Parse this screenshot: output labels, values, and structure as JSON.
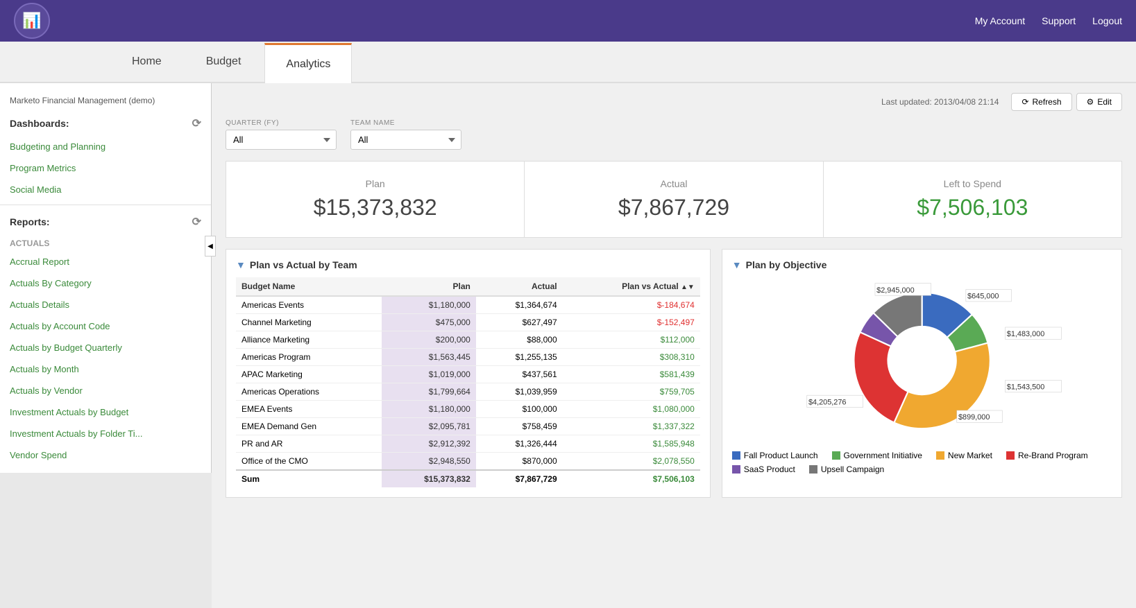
{
  "topbar": {
    "nav_links": [
      "My Account",
      "Support",
      "Logout"
    ]
  },
  "nav_tabs": [
    {
      "label": "Home",
      "active": false
    },
    {
      "label": "Budget",
      "active": false
    },
    {
      "label": "Analytics",
      "active": true
    }
  ],
  "sidebar": {
    "company": "Marketo Financial Management (demo)",
    "dashboards_label": "Dashboards:",
    "dashboard_items": [
      "Budgeting and Planning",
      "Program Metrics",
      "Social Media"
    ],
    "reports_label": "Reports:",
    "reports_section_label": "Actuals",
    "report_items": [
      "Accrual Report",
      "Actuals By Category",
      "Actuals Details",
      "Actuals by Account Code",
      "Actuals by Budget Quarterly",
      "Actuals by Month",
      "Actuals by Vendor",
      "Investment Actuals by Budget",
      "Investment Actuals by Folder Ti...",
      "Vendor Spend"
    ]
  },
  "header": {
    "last_updated": "Last updated: 2013/04/08 21:14",
    "refresh_label": "Refresh",
    "edit_label": "Edit"
  },
  "filters": {
    "quarter_label": "QUARTER (FY)",
    "quarter_value": "All",
    "team_label": "TEAM NAME",
    "team_value": "All"
  },
  "kpis": {
    "plan_label": "Plan",
    "plan_value": "$15,373,832",
    "actual_label": "Actual",
    "actual_value": "$7,867,729",
    "left_label": "Left to Spend",
    "left_value": "$7,506,103"
  },
  "table": {
    "title": "Plan vs Actual by Team",
    "columns": [
      "Budget Name",
      "Plan",
      "Actual",
      "Plan vs Actual"
    ],
    "rows": [
      {
        "name": "Americas Events",
        "plan": "$1,180,000",
        "actual": "$1,364,674",
        "pva": "-$184,674",
        "pva_neg": true
      },
      {
        "name": "Channel Marketing",
        "plan": "$475,000",
        "actual": "$627,497",
        "pva": "-$152,497",
        "pva_neg": true
      },
      {
        "name": "Alliance Marketing",
        "plan": "$200,000",
        "actual": "$88,000",
        "pva": "$112,000",
        "pva_neg": false
      },
      {
        "name": "Americas Program",
        "plan": "$1,563,445",
        "actual": "$1,255,135",
        "pva": "$308,310",
        "pva_neg": false
      },
      {
        "name": "APAC Marketing",
        "plan": "$1,019,000",
        "actual": "$437,561",
        "pva": "$581,439",
        "pva_neg": false
      },
      {
        "name": "Americas Operations",
        "plan": "$1,799,664",
        "actual": "$1,039,959",
        "pva": "$759,705",
        "pva_neg": false
      },
      {
        "name": "EMEA Events",
        "plan": "$1,180,000",
        "actual": "$100,000",
        "pva": "$1,080,000",
        "pva_neg": false
      },
      {
        "name": "EMEA Demand Gen",
        "plan": "$2,095,781",
        "actual": "$758,459",
        "pva": "$1,337,322",
        "pva_neg": false
      },
      {
        "name": "PR and AR",
        "plan": "$2,912,392",
        "actual": "$1,326,444",
        "pva": "$1,585,948",
        "pva_neg": false
      },
      {
        "name": "Office of the CMO",
        "plan": "$2,948,550",
        "actual": "$870,000",
        "pva": "$2,078,550",
        "pva_neg": false
      }
    ],
    "sum_row": {
      "name": "Sum",
      "plan": "$15,373,832",
      "actual": "$7,867,729",
      "pva": "$7,506,103",
      "pva_neg": false
    }
  },
  "donut_chart": {
    "title": "Plan by Objective",
    "segments": [
      {
        "label": "Fall Product Launch",
        "value": 1543500,
        "color": "#3a6bbf",
        "pct": 0.1
      },
      {
        "label": "Government Initiative",
        "value": 899000,
        "color": "#5aaa55",
        "pct": 0.058
      },
      {
        "label": "New Market",
        "value": 4205276,
        "color": "#f0a830",
        "pct": 0.274
      },
      {
        "label": "Re-Brand Program",
        "value": 2945000,
        "color": "#dd3333",
        "pct": 0.192
      },
      {
        "label": "SaaS Product",
        "value": 645000,
        "color": "#7755aa",
        "pct": 0.042
      },
      {
        "label": "Upsell Campaign",
        "value": 1483000,
        "color": "#777777",
        "pct": 0.097
      }
    ],
    "labels": {
      "top_left": "$2,945,000",
      "top_right": "$645,000",
      "right_upper": "$1,483,000",
      "right_lower": "$1,543,500",
      "bottom_right": "$899,000",
      "left": "$4,205,276"
    }
  }
}
